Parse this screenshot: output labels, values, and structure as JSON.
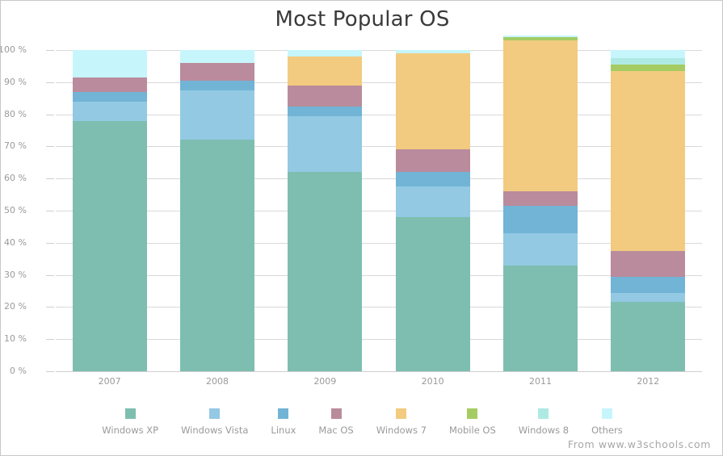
{
  "chart_data": {
    "type": "bar",
    "subtype": "stacked-percent",
    "title": "Most Popular OS",
    "xlabel": "",
    "ylabel": "",
    "categories": [
      "2007",
      "2008",
      "2009",
      "2010",
      "2011",
      "2012"
    ],
    "ylim": [
      0,
      100
    ],
    "ytick_labels": [
      "0 %",
      "10 %",
      "20 %",
      "30 %",
      "40 %",
      "50 %",
      "60 %",
      "70 %",
      "80 %",
      "90 %",
      "100 %"
    ],
    "ytick_values": [
      0,
      10,
      20,
      30,
      40,
      50,
      60,
      70,
      80,
      90,
      100
    ],
    "grid": true,
    "legend_position": "bottom",
    "series": [
      {
        "name": "Windows XP",
        "color": "#7dbeb0",
        "values": [
          78,
          72,
          62,
          48,
          33,
          21.5
        ]
      },
      {
        "name": "Windows Vista",
        "color": "#93c9e3",
        "values": [
          6,
          15.5,
          17.5,
          9.5,
          10,
          3
        ]
      },
      {
        "name": "Linux",
        "color": "#71b4d6",
        "values": [
          3,
          3,
          3,
          4.5,
          8.5,
          5
        ]
      },
      {
        "name": "Mac OS",
        "color": "#ba8b9c",
        "values": [
          4.5,
          5.5,
          6.5,
          7,
          4.5,
          8
        ]
      },
      {
        "name": "Windows 7",
        "color": "#f2cb80",
        "values": [
          0,
          0,
          9,
          30,
          47,
          56
        ]
      },
      {
        "name": "Mobile OS",
        "color": "#a4cc63",
        "values": [
          0,
          0,
          0,
          0,
          1,
          2
        ]
      },
      {
        "name": "Windows 8",
        "color": "#aeeae3",
        "values": [
          0,
          0,
          0,
          0,
          0,
          2
        ]
      },
      {
        "name": "Others",
        "color": "#c6f6fc",
        "values": [
          8.5,
          4,
          2,
          1,
          0.5,
          2.5
        ]
      }
    ]
  },
  "credit": "From www.w3schools.com"
}
